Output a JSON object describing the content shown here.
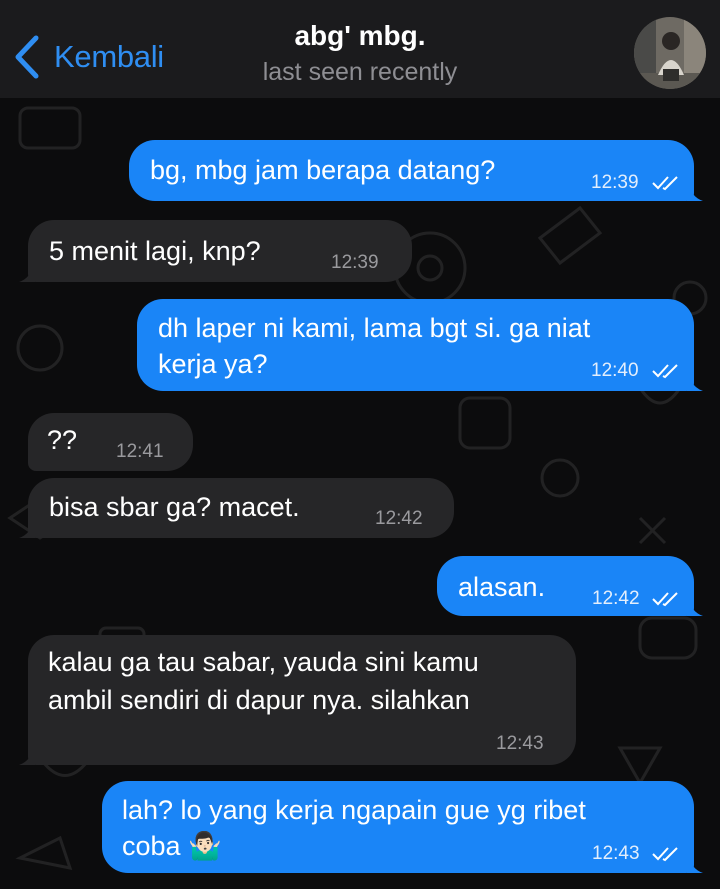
{
  "header": {
    "back_label": "Kembali",
    "title": "abg' mbg.",
    "status": "last seen recently"
  },
  "colors": {
    "accent": "#2f8ef2",
    "outgoing_bubble": "#1a85f7",
    "incoming_bubble": "#262628",
    "background": "#0c0c0d",
    "header_bg": "#1b1b1d"
  },
  "messages": [
    {
      "direction": "outgoing",
      "lines": [
        "bg, mbg jam berapa datang?"
      ],
      "time": "12:39",
      "status": "read-double-check-icon"
    },
    {
      "direction": "incoming",
      "lines": [
        "5 menit lagi, knp?"
      ],
      "time": "12:39"
    },
    {
      "direction": "outgoing",
      "lines": [
        "dh laper ni kami, lama bgt si. ga niat",
        "kerja ya?"
      ],
      "time": "12:40",
      "status": "read-double-check-icon"
    },
    {
      "direction": "incoming",
      "lines": [
        "??"
      ],
      "time": "12:41"
    },
    {
      "direction": "incoming",
      "lines": [
        "bisa sbar ga? macet."
      ],
      "time": "12:42"
    },
    {
      "direction": "outgoing",
      "lines": [
        "alasan."
      ],
      "time": "12:42",
      "status": "read-double-check-icon"
    },
    {
      "direction": "incoming",
      "lines": [
        "kalau ga tau sabar, yauda sini kamu",
        "ambil sendiri di dapur nya. silahkan"
      ],
      "time": "12:43"
    },
    {
      "direction": "outgoing",
      "lines": [
        "lah? lo yang kerja ngapain gue yg ribet",
        "coba 🤷🏻‍♂️"
      ],
      "time": "12:43",
      "status": "read-double-check-icon"
    }
  ]
}
